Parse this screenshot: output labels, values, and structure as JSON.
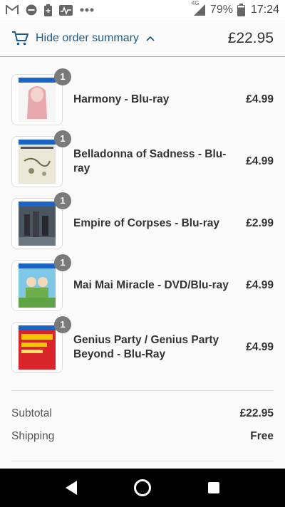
{
  "status_bar": {
    "time": "17:24",
    "battery": "79%",
    "network": "4G",
    "icons": [
      "gmail-icon",
      "do-not-disturb-icon",
      "battery-saver-icon",
      "activity-icon",
      "more-dots-icon"
    ]
  },
  "summary": {
    "toggle_label": "Hide order summary",
    "total": "£22.95"
  },
  "items": [
    {
      "name": "Harmony - Blu-ray",
      "price": "£4.99",
      "quantity": "1"
    },
    {
      "name": "Belladonna of Sadness - Blu-ray",
      "price": "£4.99",
      "quantity": "1"
    },
    {
      "name": "Empire of Corpses - Blu-ray",
      "price": "£2.99",
      "quantity": "1"
    },
    {
      "name": "Mai Mai Miracle - DVD/Blu-ray",
      "price": "£4.99",
      "quantity": "1"
    },
    {
      "name": "Genius Party / Genius Party Beyond - Blu-Ray",
      "price": "£4.99",
      "quantity": "1"
    }
  ],
  "totals": {
    "subtotal_label": "Subtotal",
    "subtotal_value": "£22.95",
    "shipping_label": "Shipping",
    "shipping_value": "Free"
  },
  "colors": {
    "accent": "#1f5c8a",
    "border_accent": "#e6a817",
    "badge": "#7a7a7a"
  }
}
